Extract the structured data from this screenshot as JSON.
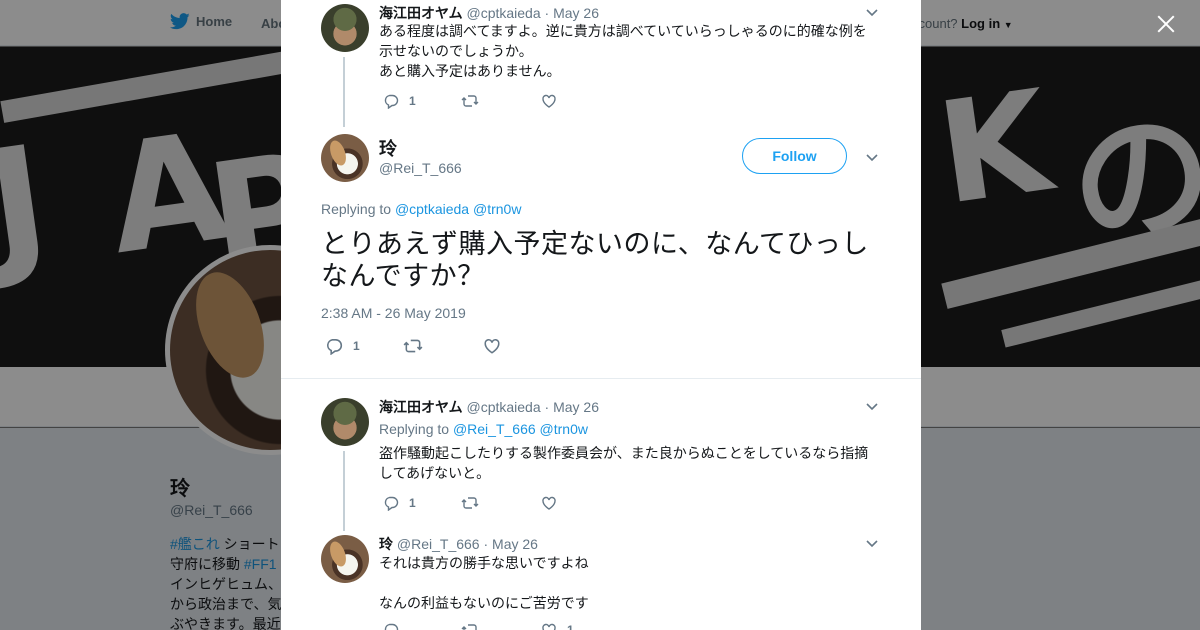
{
  "background": {
    "nav": {
      "home_label": "Home",
      "about_label": "Abo",
      "account_question": "ccount?",
      "login_label": "Log in"
    },
    "profile": {
      "name": "玲",
      "handle": "@Rei_T_666",
      "bio_lines": [
        {
          "tag": "#艦これ",
          "text": " ショート"
        },
        {
          "text": "守府に移動 ",
          "tag": "#FF1"
        },
        {
          "text": "インヒゲヒュム、"
        },
        {
          "text": "から政治まで、気"
        },
        {
          "text": "ぶやきます。最近"
        }
      ]
    }
  },
  "modal": {
    "close_label": "Close",
    "parent_tweet": {
      "name": "海江田オヤム",
      "handle": "@cptkaieda",
      "date": "· May 26",
      "text_lines": [
        "ある程度は調べてますよ。逆に貴方は調べていていらっしゃるのに的確な例を",
        "示せないのでしょうか。",
        "あと購入予定はありません。"
      ],
      "reply_count": "1",
      "retweet_count": "",
      "like_count": ""
    },
    "main_tweet": {
      "name": "玲",
      "handle": "@Rei_T_666",
      "follow_label": "Follow",
      "replying_to_label": "Replying to",
      "mentions": [
        "@cptkaieda",
        "@trn0w"
      ],
      "text": "とりあえず購入予定ないのに、なんてひっしなんですか？",
      "timestamp": "2:38 AM - 26 May 2019",
      "reply_count": "1",
      "retweet_count": "",
      "like_count": ""
    },
    "replies": [
      {
        "name": "海江田オヤム",
        "handle": "@cptkaieda",
        "date": "· May 26",
        "replying_to_label": "Replying to",
        "mentions": [
          "@Rei_T_666",
          "@trn0w"
        ],
        "text_lines": [
          "盗作騒動起こしたりする製作委員会が、また良からぬことをしているなら指摘",
          "してあげないと。"
        ],
        "reply_count": "1",
        "retweet_count": "",
        "like_count": ""
      },
      {
        "name": "玲",
        "handle": "@Rei_T_666",
        "date": "· May 26",
        "text_lines": [
          "それは貴方の勝手な思いですよね",
          "",
          "なんの利益もないのにご苦労です"
        ],
        "reply_count": "",
        "retweet_count": "",
        "like_count": "1"
      }
    ]
  },
  "colors": {
    "accent": "#1da1f2",
    "link": "#1b95e0",
    "muted": "#657786",
    "text": "#14171a",
    "overlay": "rgba(0,0,0,0.45)"
  },
  "icons": [
    "twitter-bird-icon",
    "close-icon",
    "chevron-down-icon",
    "reply-icon",
    "retweet-icon",
    "like-icon"
  ]
}
